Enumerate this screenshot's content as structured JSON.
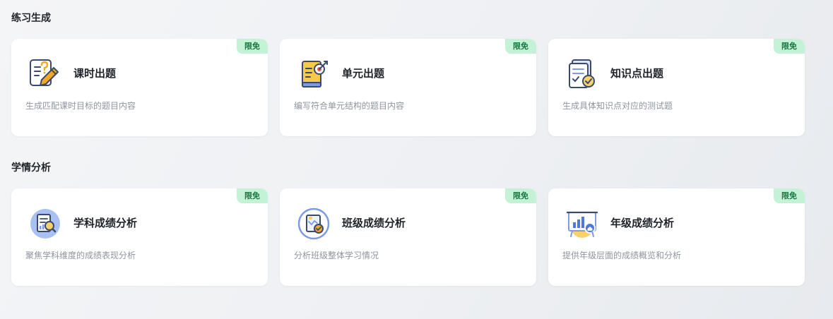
{
  "sections": [
    {
      "title": "练习生成",
      "cards": [
        {
          "title": "课时出题",
          "desc": "生成匹配课时目标的题目内容",
          "badge": "限免",
          "icon": "question-pencil-icon"
        },
        {
          "title": "单元出题",
          "desc": "编写符合单元结构的题目内容",
          "badge": "限免",
          "icon": "book-target-icon"
        },
        {
          "title": "知识点出题",
          "desc": "生成具体知识点对应的测试题",
          "badge": "限免",
          "icon": "document-check-icon"
        }
      ]
    },
    {
      "title": "学情分析",
      "cards": [
        {
          "title": "学科成绩分析",
          "desc": "聚焦学科维度的成绩表现分析",
          "badge": "限免",
          "icon": "report-magnifier-icon"
        },
        {
          "title": "班级成绩分析",
          "desc": "分析班级整体学习情况",
          "badge": "限免",
          "icon": "chart-check-circle-icon"
        },
        {
          "title": "年级成绩分析",
          "desc": "提供年级层面的成绩概览和分析",
          "badge": "限免",
          "icon": "bar-chart-home-icon"
        }
      ]
    }
  ],
  "colors": {
    "badge_bg": "#c4f2d6",
    "badge_text": "#17783f",
    "icon_outline": "#3a4a6b",
    "icon_orange": "#f5a623",
    "icon_blue": "#7c9be6",
    "icon_yellow": "#f7d26a"
  }
}
